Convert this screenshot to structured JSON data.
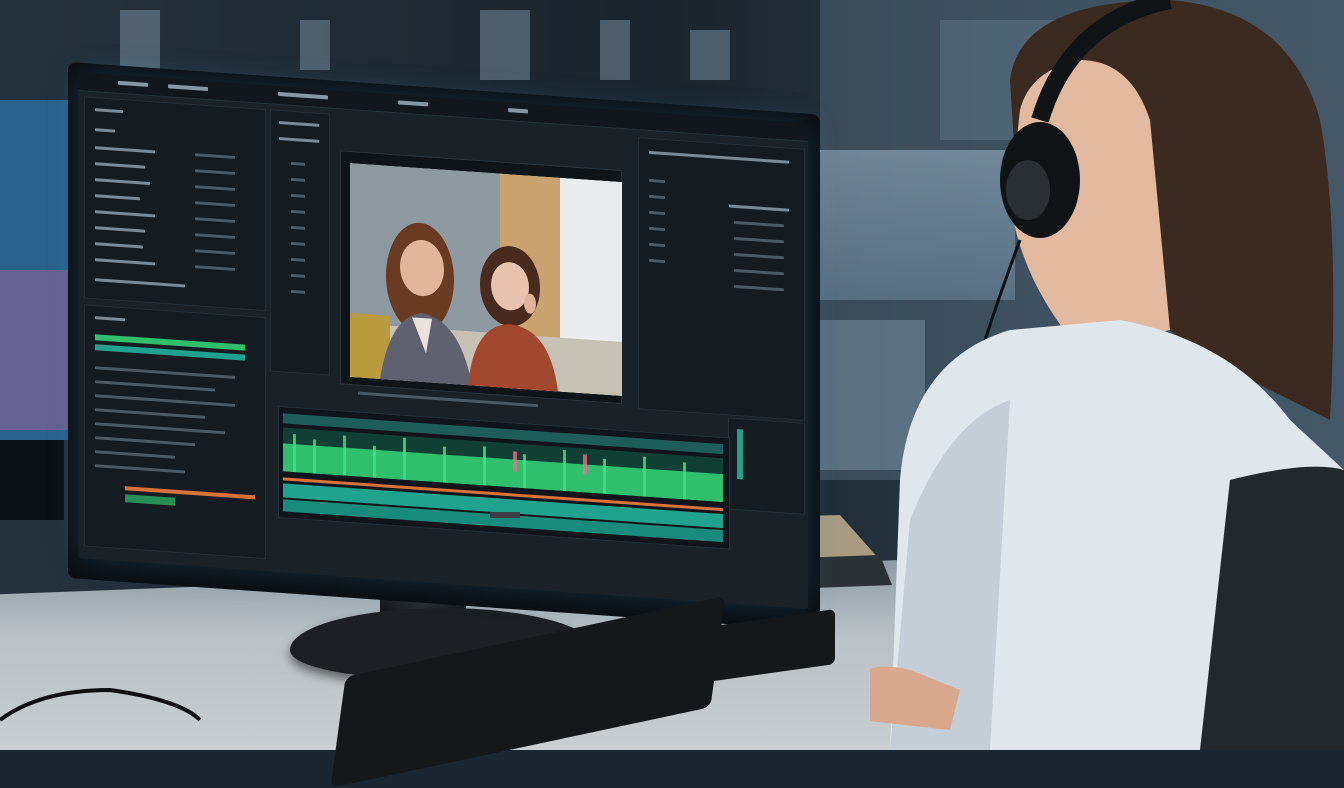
{
  "scene": {
    "description_colors": {
      "background": "#1b2631",
      "screen": "#1a2228",
      "waveform_green": "#2fbf6d",
      "waveform_teal": "#1fa38f",
      "accent_orange": "#d9733b",
      "desk": "#b9c1c6",
      "shirt": "#dfe6ec"
    }
  }
}
